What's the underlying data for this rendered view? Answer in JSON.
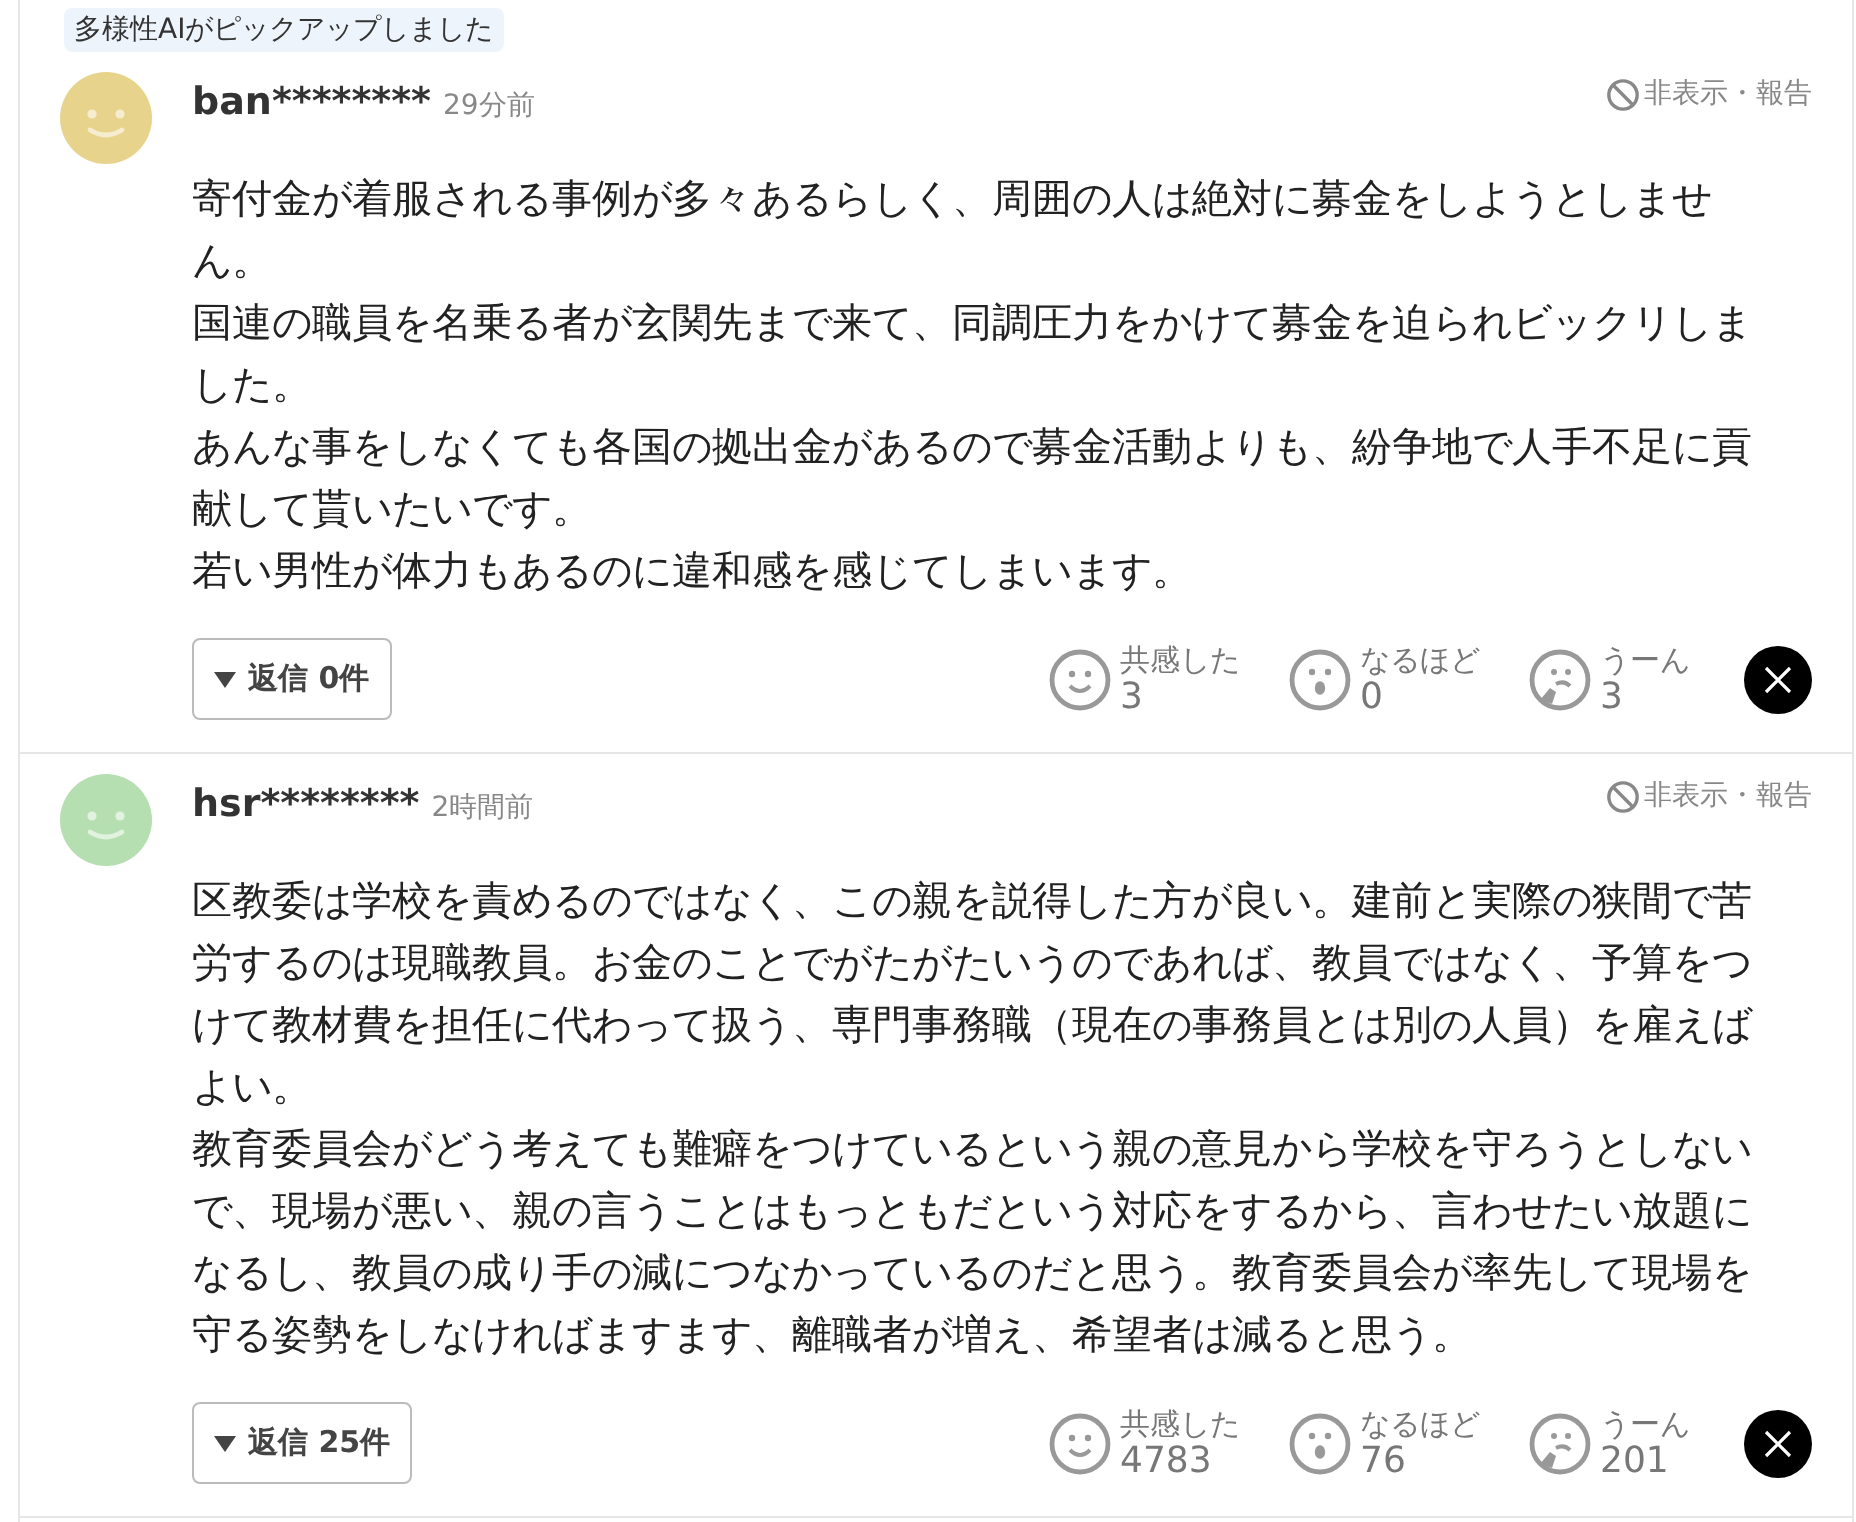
{
  "pickup_badge": "多様性AIがピックアップしました",
  "comments": [
    {
      "user": "ban********",
      "time": "29分前",
      "color": "#e8d38c",
      "hide_report": "非表示・報告",
      "paragraphs": [
        "寄付金が着服される事例が多々あるらしく、周囲の人は絶対に募金をしようとしません。",
        "国連の職員を名乗る者が玄関先まで来て、同調圧力をかけて募金を迫られビックリしました。",
        "あんな事をしなくても各国の拠出金があるので募金活動よりも、紛争地で人手不足に貢献して貰いたいです。",
        "若い男性が体力もあるのに違和感を感じてしまいます。"
      ],
      "replies": "返信 0件",
      "reactions": [
        {
          "kind": "smile",
          "label": "共感した",
          "count": "3"
        },
        {
          "kind": "surprise",
          "label": "なるほど",
          "count": "0"
        },
        {
          "kind": "think",
          "label": "うーん",
          "count": "3"
        }
      ]
    },
    {
      "user": "hsr********",
      "time": "2時間前",
      "color": "#b5dfb0",
      "hide_report": "非表示・報告",
      "paragraphs": [
        "区教委は学校を責めるのではなく、この親を説得した方が良い。建前と実際の狭間で苦労するのは現職教員。お金のことでがたがたいうのであれば、教員ではなく、予算をつけて教材費を担任に代わって扱う、専門事務職（現在の事務員とは別の人員）を雇えばよい。",
        "教育委員会がどう考えても難癖をつけているという親の意見から学校を守ろうとしないで、現場が悪い、親の言うことはもっともだという対応をするから、言わせたい放題になるし、教員の成り手の減につなかっているのだと思う。教育委員会が率先して現場を守る姿勢をしなければますます、離職者が増え、希望者は減ると思う。"
      ],
      "replies": "返信 25件",
      "reactions": [
        {
          "kind": "smile",
          "label": "共感した",
          "count": "4783"
        },
        {
          "kind": "surprise",
          "label": "なるほど",
          "count": "76"
        },
        {
          "kind": "think",
          "label": "うーん",
          "count": "201"
        }
      ]
    }
  ]
}
